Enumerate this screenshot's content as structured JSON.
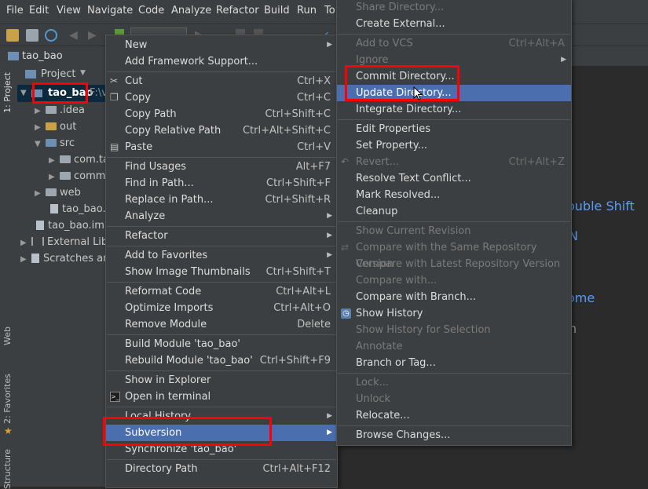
{
  "menubar": [
    "File",
    "Edit",
    "View",
    "Navigate",
    "Code",
    "Analyze",
    "Refactor",
    "Build",
    "Run",
    "To"
  ],
  "breadcrumb": {
    "root": "tao_bao"
  },
  "left_tabs": {
    "project": "1: Project",
    "web": "Web",
    "favorites": "2: Favorites",
    "structure": "Structure"
  },
  "project_header": {
    "label": "Project"
  },
  "tree": [
    {
      "label": "tao_bao",
      "extra": "F:\\v",
      "bold": true
    },
    {
      "label": ".idea"
    },
    {
      "label": "out"
    },
    {
      "label": "src"
    },
    {
      "label": "com.ta"
    },
    {
      "label": "comm"
    },
    {
      "label": "web"
    },
    {
      "label": "tao_bao.i"
    },
    {
      "label": "tao_bao.iml"
    },
    {
      "label": "External Libr"
    },
    {
      "label": "Scratches an"
    }
  ],
  "editor_hints": [
    "ouble Shift",
    "N",
    "ome",
    "n"
  ],
  "context_menu": [
    {
      "label": "New",
      "shortcut": "",
      "submenu": true
    },
    {
      "label": "Add Framework Support...",
      "shortcut": ""
    },
    {
      "label": "Cut",
      "shortcut": "Ctrl+X",
      "icon": "scissors-icon"
    },
    {
      "label": "Copy",
      "shortcut": "Ctrl+C",
      "icon": "copy-icon"
    },
    {
      "label": "Copy Path",
      "shortcut": "Ctrl+Shift+C"
    },
    {
      "label": "Copy Relative Path",
      "shortcut": "Ctrl+Alt+Shift+C"
    },
    {
      "label": "Paste",
      "shortcut": "Ctrl+V",
      "icon": "paste-icon"
    },
    {
      "label": "Find Usages",
      "shortcut": "Alt+F7"
    },
    {
      "label": "Find in Path...",
      "shortcut": "Ctrl+Shift+F"
    },
    {
      "label": "Replace in Path...",
      "shortcut": "Ctrl+Shift+R"
    },
    {
      "label": "Analyze",
      "shortcut": "",
      "submenu": true
    },
    {
      "label": "Refactor",
      "shortcut": "",
      "submenu": true
    },
    {
      "label": "Add to Favorites",
      "shortcut": "",
      "submenu": true
    },
    {
      "label": "Show Image Thumbnails",
      "shortcut": "Ctrl+Shift+T"
    },
    {
      "label": "Reformat Code",
      "shortcut": "Ctrl+Alt+L"
    },
    {
      "label": "Optimize Imports",
      "shortcut": "Ctrl+Alt+O"
    },
    {
      "label": "Remove Module",
      "shortcut": "Delete"
    },
    {
      "label": "Build Module 'tao_bao'",
      "shortcut": ""
    },
    {
      "label": "Rebuild Module 'tao_bao'",
      "shortcut": "Ctrl+Shift+F9"
    },
    {
      "label": "Show in Explorer",
      "shortcut": ""
    },
    {
      "label": "Open in terminal",
      "shortcut": "",
      "icon": "terminal-icon"
    },
    {
      "label": "Local History",
      "shortcut": "",
      "submenu": true
    },
    {
      "label": "Subversion",
      "shortcut": "",
      "submenu": true,
      "selected": true
    },
    {
      "label": "Synchronize 'tao_bao'",
      "shortcut": ""
    },
    {
      "label": "Directory Path",
      "shortcut": "Ctrl+Alt+F12"
    }
  ],
  "subversion_menu": [
    {
      "label": "Share Directory...",
      "disabled": true
    },
    {
      "label": "Create External..."
    },
    {
      "label": "Add to VCS",
      "shortcut": "Ctrl+Alt+A",
      "disabled": true
    },
    {
      "label": "Ignore",
      "submenu": true,
      "disabled": true
    },
    {
      "label": "Commit Directory..."
    },
    {
      "label": "Update Directory...",
      "selected": true
    },
    {
      "label": "Integrate Directory..."
    },
    {
      "label": "Edit Properties"
    },
    {
      "label": "Set Property..."
    },
    {
      "label": "Revert...",
      "shortcut": "Ctrl+Alt+Z",
      "disabled": true
    },
    {
      "label": "Resolve Text Conflict..."
    },
    {
      "label": "Mark Resolved..."
    },
    {
      "label": "Cleanup"
    },
    {
      "label": "Show Current Revision",
      "disabled": true
    },
    {
      "label": "Compare with the Same Repository Version",
      "disabled": true
    },
    {
      "label": "Compare with Latest Repository Version",
      "disabled": true
    },
    {
      "label": "Compare with...",
      "disabled": true
    },
    {
      "label": "Compare with Branch..."
    },
    {
      "label": "Show History"
    },
    {
      "label": "Show History for Selection",
      "disabled": true
    },
    {
      "label": "Annotate",
      "disabled": true
    },
    {
      "label": "Branch or Tag..."
    },
    {
      "label": "Lock...",
      "disabled": true
    },
    {
      "label": "Unlock",
      "disabled": true
    },
    {
      "label": "Relocate..."
    },
    {
      "label": "Browse Changes..."
    }
  ],
  "colors": {
    "accent": "#4b6eaf",
    "highlight": "#ff0000",
    "hint": "#589df6"
  }
}
